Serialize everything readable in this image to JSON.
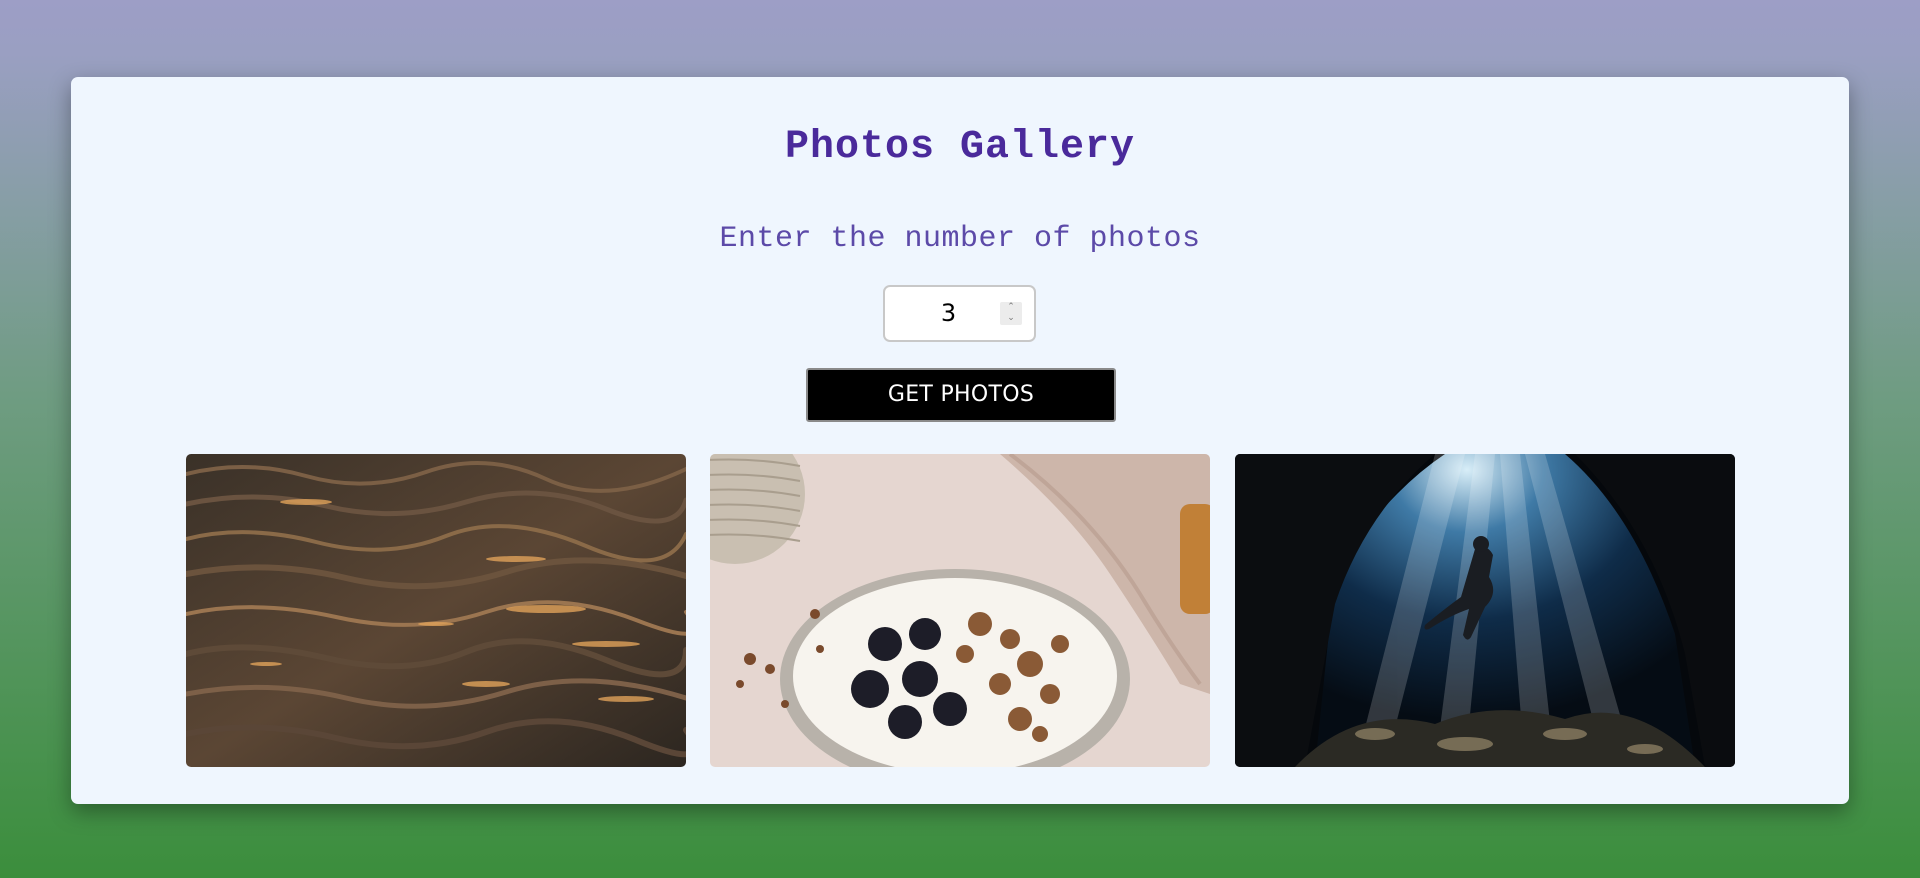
{
  "gallery": {
    "title": "Photos Gallery",
    "prompt": "Enter the number of photos",
    "count_value": "3",
    "button_label": "GET PHOTOS"
  },
  "photos": [
    {
      "icon": "ocean-waves-photo"
    },
    {
      "icon": "granola-bowl-photo"
    },
    {
      "icon": "underwater-cave-diver-photo"
    }
  ],
  "colors": {
    "title": "#4a2a9b",
    "prompt": "#5c4aa8",
    "card_bg": "#eff6fe",
    "button_bg": "#000000"
  }
}
